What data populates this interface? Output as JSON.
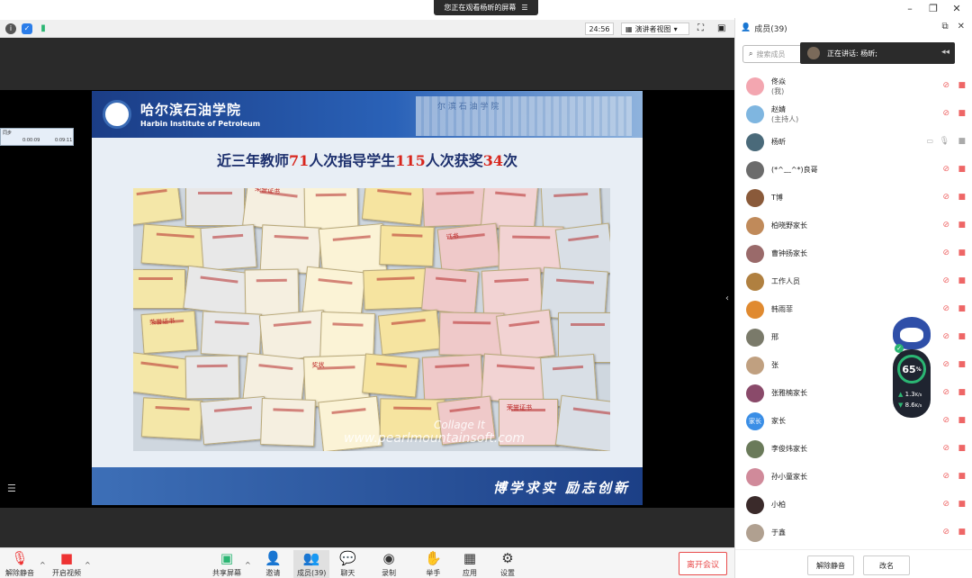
{
  "banner": {
    "text": "您正在观看杨昕的屏幕",
    "icon": "menu-icon"
  },
  "toolbar": {
    "timer": "24:56",
    "view_mode": "演讲者视图",
    "view_caret": "▾"
  },
  "recorder": {
    "label": "同步",
    "time_a": "0:00:09",
    "time_b": "0:09:11"
  },
  "slide": {
    "school_cn": "哈尔滨石油学院",
    "school_en": "Harbin Institute of Petroleum",
    "building_text": "尔 滨 石 油 学 院",
    "title_parts": [
      "近三年教师",
      "71",
      "人次指导学生",
      "115",
      "人次获奖",
      "34",
      "次"
    ],
    "watermark_line1": "Collage It",
    "watermark_line2": "www.pearlmountainsoft.com",
    "motto": "博学求实 励志创新",
    "cert_labels": [
      "荣誉证书",
      "证书",
      "荣誉证书",
      "奖状"
    ]
  },
  "bottombar": {
    "unmute": "解除静音",
    "start_video": "开启视频",
    "share": "共享屏幕",
    "invite": "邀请",
    "members": "成员(39)",
    "chat": "聊天",
    "record": "录制",
    "raise_hand": "举手",
    "apps": "应用",
    "settings": "设置",
    "leave": "离开会议"
  },
  "panel": {
    "title": "成员(39)",
    "search_placeholder": "搜索成员",
    "speaking": "正在讲话: 杨昕;",
    "unmute_all": "解除静音",
    "rename": "改名",
    "members": [
      {
        "name": "佟焱",
        "role": "(我)",
        "avatar_color": "#f3a6b0"
      },
      {
        "name": "赵婧",
        "role": "(主持人)",
        "avatar_color": "#7fb6e0"
      },
      {
        "name": "杨昕",
        "role": "",
        "avatar_color": "#4a6a7a"
      },
      {
        "name": "(*^﹏^*)良哥",
        "role": "",
        "avatar_color": "#6b6b6b"
      },
      {
        "name": "T博",
        "role": "",
        "avatar_color": "#8a5a3a"
      },
      {
        "name": "柏晓野家长",
        "role": "",
        "avatar_color": "#c08a5a"
      },
      {
        "name": "曹钟扬家长",
        "role": "",
        "avatar_color": "#9a6a6a"
      },
      {
        "name": "工作人员",
        "role": "",
        "avatar_color": "#b08040"
      },
      {
        "name": "韩雨菲",
        "role": "",
        "avatar_color": "#e08a30"
      },
      {
        "name": "邢",
        "role": "",
        "avatar_color": "#7a7a6a"
      },
      {
        "name": "张",
        "role": "",
        "avatar_color": "#c0a080"
      },
      {
        "name": "张雅楠家长",
        "role": "",
        "avatar_color": "#8a4a6a"
      },
      {
        "name": "家长",
        "role": "",
        "avatar_color": "#3a8ee6",
        "avatar_text": "家长"
      },
      {
        "name": "李俊炜家长",
        "role": "",
        "avatar_color": "#6a7a5a"
      },
      {
        "name": "孙小童家长",
        "role": "",
        "avatar_color": "#d08a9a"
      },
      {
        "name": "小柏",
        "role": "",
        "avatar_color": "#3a2a2a"
      },
      {
        "name": "于鑫",
        "role": "",
        "avatar_color": "#b0a090"
      }
    ]
  },
  "gauge": {
    "value": "65",
    "unit": "%",
    "up": "1.3",
    "down": "8.6",
    "speed_unit": "K/s"
  }
}
